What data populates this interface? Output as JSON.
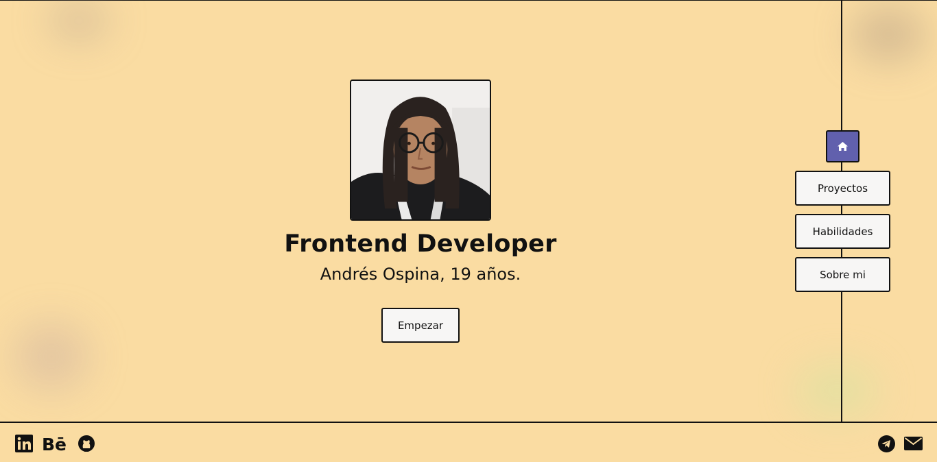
{
  "hero": {
    "title": "Frontend Developer",
    "subtitle": "Andrés Ospina, 19 años.",
    "start_label": "Empezar"
  },
  "nav": {
    "home_icon": "home-icon",
    "items": [
      {
        "label": "Proyectos"
      },
      {
        "label": "Habilidades"
      },
      {
        "label": "Sobre mi"
      }
    ]
  },
  "footer": {
    "left_icons": [
      "linkedin-icon",
      "behance-icon",
      "github-icon"
    ],
    "right_icons": [
      "telegram-icon",
      "mail-icon"
    ]
  },
  "colors": {
    "background": "#fadca2",
    "accent": "#6160ad",
    "button_bg": "#f7f6f5",
    "ink": "#111111"
  }
}
